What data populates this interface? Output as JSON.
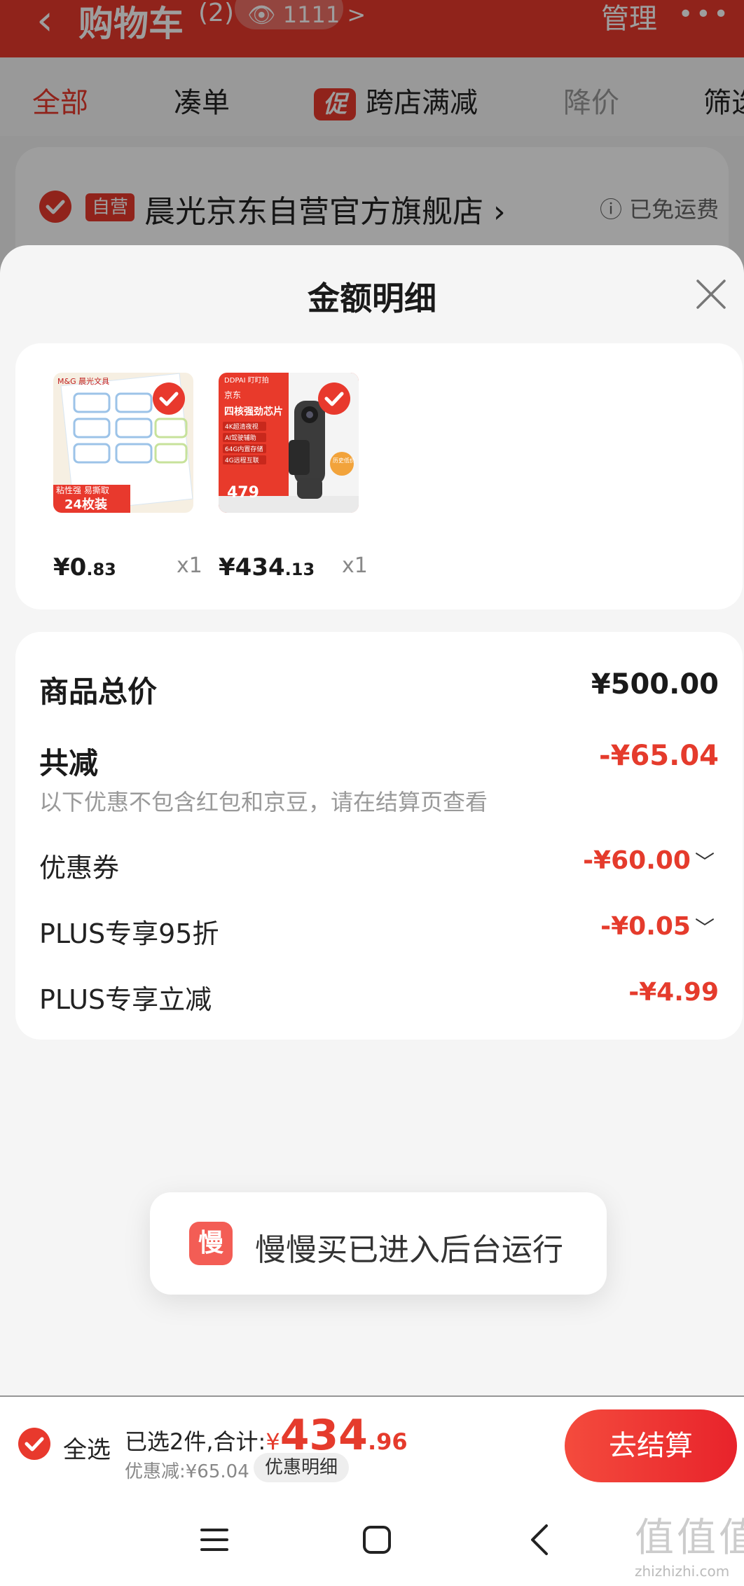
{
  "header": {
    "back_icon": "chevron-left-icon",
    "title": "购物车",
    "count": "(2)",
    "watch_count": "1111 >",
    "manage_label": "管理",
    "more_icon": "more-icon"
  },
  "tabs": [
    "全部",
    "凑单",
    "跨店满减",
    "降价",
    "筛选"
  ],
  "promo_badge": "促",
  "store": {
    "self_badge": "自营",
    "name": "晨光京东自营官方旗舰店 ›",
    "shipping": "ⓘ 已免运费"
  },
  "sheet": {
    "title": "金额明细",
    "close_icon": "close-icon"
  },
  "products": [
    {
      "price_int": "¥0",
      "price_dec": ".83",
      "qty": "x1",
      "thumb_text": "24枚装",
      "thumb_sub": "粘性强 易撕取",
      "thumb_brand": "M&G 晨光文具"
    },
    {
      "price_int": "¥434",
      "price_dec": ".13",
      "qty": "x1",
      "thumb_brand": "DDPAI 盯盯拍",
      "thumb_tag": "京东",
      "thumb_heading": "四核强劲芯片",
      "thumb_features": [
        "4K超清夜视",
        "AI驾驶辅助",
        "64G内置存储",
        "4G远程互联"
      ],
      "thumb_price": "479",
      "thumb_badge": "历史低价"
    }
  ],
  "summary": {
    "total_label": "商品总价",
    "total_value": "¥500.00",
    "reduce_label": "共减",
    "reduce_value": "-¥65.04",
    "note": "以下优惠不包含红包和京豆，请在结算页查看",
    "items": [
      {
        "label": "优惠券",
        "value": "-¥60.00"
      },
      {
        "label": "PLUS专享95折",
        "value": "-¥0.05"
      },
      {
        "label": "PLUS专享立减",
        "value": "-¥4.99"
      }
    ]
  },
  "toast": {
    "icon_text": "慢",
    "text": "慢慢买已进入后台运行"
  },
  "checkout": {
    "select_all": "全选",
    "selected_text": "已选2件,合计:",
    "currency": "¥",
    "total_int": "434",
    "total_dec": ".96",
    "discount_text": "优惠减:¥65.04",
    "detail_label": "优惠明细",
    "button_label": "去结算"
  },
  "watermark": {
    "big": "值值值",
    "small": "zhizhizhi.com"
  },
  "colors": {
    "brand_red": "#e8392d",
    "discount_red": "#e53b2c"
  }
}
